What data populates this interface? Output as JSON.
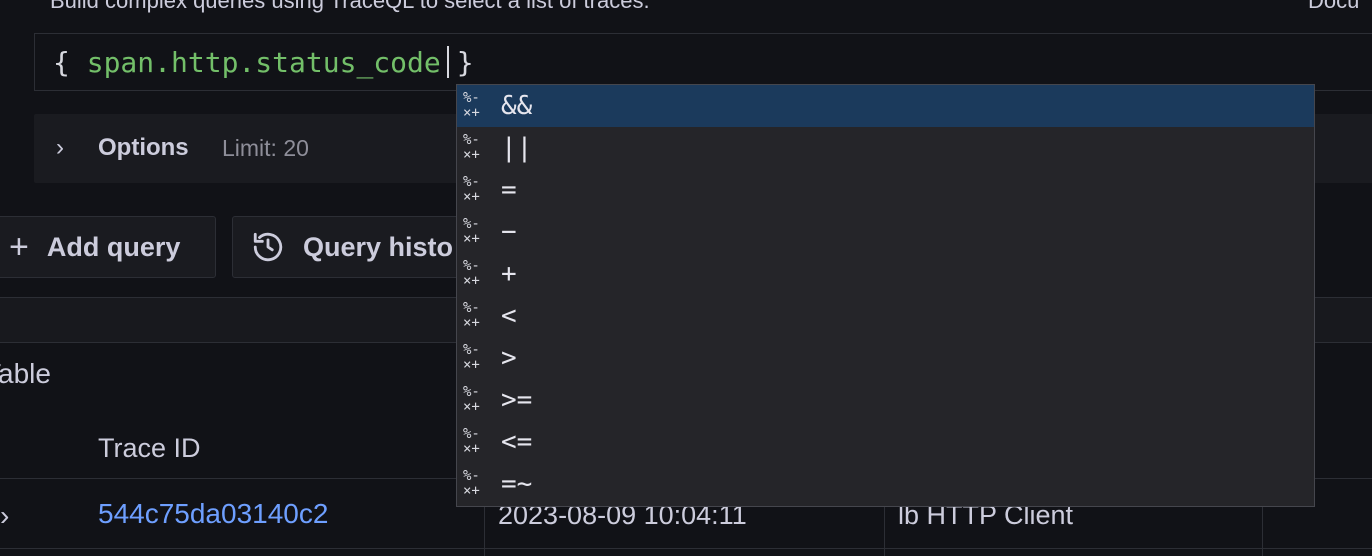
{
  "header": {
    "description": "Build complex queries using TraceQL to select a list of traces.",
    "docs_link": "Docu"
  },
  "editor": {
    "open_brace": "{",
    "attribute": "span.http.status_code",
    "close_brace": "}"
  },
  "options": {
    "label": "Options",
    "limit": "Limit: 20"
  },
  "buttons": {
    "add_query": "Add query",
    "query_history": "Query histo"
  },
  "table": {
    "title": "Table",
    "columns": [
      "Trace ID"
    ],
    "rows": [
      {
        "trace_id": "544c75da03140c2",
        "start_time": "2023-08-09 10:04:11",
        "service": "lb HTTP Client"
      }
    ]
  },
  "autocomplete": {
    "icon_top": "%-",
    "icon_bottom": "×+",
    "items": [
      "&&",
      "||",
      "=",
      "−",
      "+",
      "<",
      ">",
      ">=",
      "<=",
      "=~"
    ],
    "selected_index": 0
  },
  "colors": {
    "selected_bg": "#1b3a5c",
    "attribute_green": "#73bf69",
    "link_blue": "#6e9fff"
  }
}
